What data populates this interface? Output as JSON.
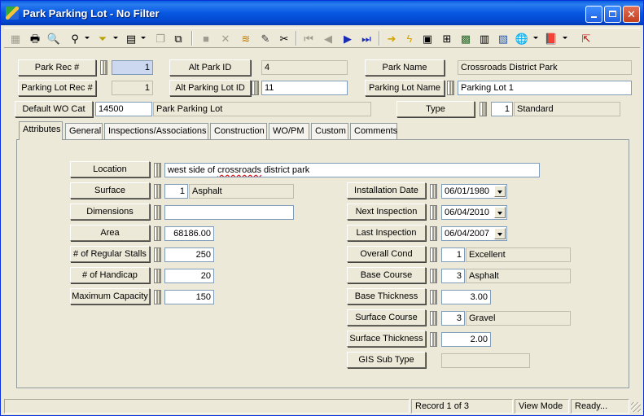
{
  "window": {
    "title": "Park Parking Lot - No Filter"
  },
  "header": {
    "park_rec": {
      "label": "Park Rec #",
      "value": "1"
    },
    "alt_park_id": {
      "label": "Alt Park ID",
      "value": "4"
    },
    "park_name": {
      "label": "Park Name",
      "value": "Crossroads District Park"
    },
    "parking_lot_rec": {
      "label": "Parking Lot Rec #",
      "value": "1"
    },
    "alt_parking_lot_id": {
      "label": "Alt Parking Lot ID",
      "value": "11"
    },
    "parking_lot_name": {
      "label": "Parking Lot Name",
      "value": "Parking Lot 1"
    },
    "default_wo_cat": {
      "label": "Default WO Cat",
      "code": "14500",
      "desc": "Park Parking Lot"
    },
    "type": {
      "label": "Type",
      "code": "1",
      "desc": "Standard"
    }
  },
  "tabs": [
    "Attributes",
    "General",
    "Inspections/Associations",
    "Construction",
    "WO/PM",
    "Custom",
    "Comments"
  ],
  "attributes": {
    "location": {
      "label": "Location",
      "value_prefix": "west side of ",
      "value_misspelled": "crossroads",
      "value_suffix": " district park"
    },
    "surface": {
      "label": "Surface",
      "code": "1",
      "desc": "Asphalt"
    },
    "dimensions": {
      "label": "Dimensions",
      "value": ""
    },
    "area": {
      "label": "Area",
      "value": "68186.00"
    },
    "regular_stalls": {
      "label": "# of Regular Stalls",
      "value": "250"
    },
    "handicap": {
      "label": "# of Handicap",
      "value": "20"
    },
    "max_capacity": {
      "label": "Maximum Capacity",
      "value": "150"
    },
    "installation_date": {
      "label": "Installation Date",
      "value": "06/01/1980"
    },
    "next_inspection": {
      "label": "Next Inspection",
      "value": "06/04/2010"
    },
    "last_inspection": {
      "label": "Last Inspection",
      "value": "06/04/2007"
    },
    "overall_cond": {
      "label": "Overall Cond",
      "code": "1",
      "desc": "Excellent"
    },
    "base_course": {
      "label": "Base Course",
      "code": "3",
      "desc": "Asphalt"
    },
    "base_thickness": {
      "label": "Base Thickness",
      "value": "3.00"
    },
    "surface_course": {
      "label": "Surface Course",
      "code": "3",
      "desc": "Gravel"
    },
    "surface_thickness": {
      "label": "Surface Thickness",
      "value": "2.00"
    },
    "gis_sub_type": {
      "label": "GIS Sub Type",
      "value": ""
    }
  },
  "status": {
    "record": "Record 1 of 3",
    "mode": "View Mode",
    "state": "Ready..."
  }
}
